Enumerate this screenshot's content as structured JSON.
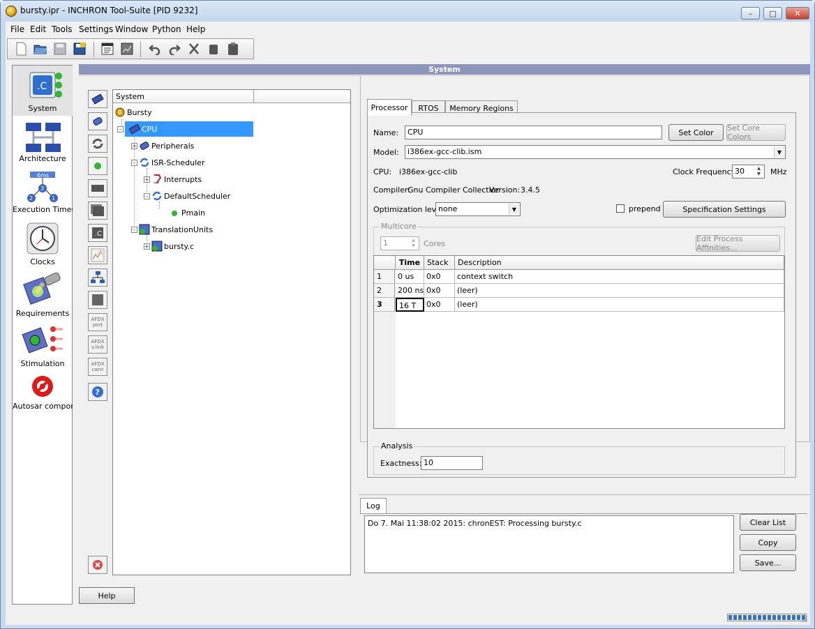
{
  "window": {
    "title": "bursty.ipr - INCHRON Tool-Suite [PID 9232]",
    "buttons": {
      "minimize": "–",
      "maximize": "□",
      "close": "✕"
    }
  },
  "menubar": {
    "items": [
      "File",
      "Edit",
      "Tools",
      "Settings",
      "Window",
      "Python",
      "Help"
    ]
  },
  "toolbar": {
    "icons": [
      "new-document-icon",
      "open-icon",
      "save-icon",
      "save-all-icon",
      "properties-icon",
      "report-icon",
      "undo-icon",
      "redo-icon",
      "cut-icon",
      "copy-icon",
      "paste-icon"
    ]
  },
  "leftnav": {
    "items": [
      {
        "label": "System",
        "icon": "system-icon"
      },
      {
        "label": "Architecture",
        "icon": "architecture-icon"
      },
      {
        "label": "Execution Times",
        "icon": "execution-times-icon",
        "badge": "6ms"
      },
      {
        "label": "Clocks",
        "icon": "clock-icon"
      },
      {
        "label": "Requirements",
        "icon": "requirements-icon"
      },
      {
        "label": "Stimulation",
        "icon": "stimulation-icon"
      },
      {
        "label": "Autosar componen",
        "icon": "autosar-icon"
      }
    ]
  },
  "main": {
    "header": "System",
    "vtools": [
      {
        "name": "add-cpu-tool",
        "text": ""
      },
      {
        "name": "add-peripheral-tool",
        "text": ""
      },
      {
        "name": "add-scheduler-tool",
        "text": ""
      },
      {
        "name": "add-process-tool",
        "text": ""
      },
      {
        "name": "add-block-tool",
        "text": ""
      },
      {
        "name": "add-stack-tool",
        "text": ""
      },
      {
        "name": "add-c-file-tool",
        "text": ""
      },
      {
        "name": "add-signal-tool",
        "text": ""
      },
      {
        "name": "add-network-tool",
        "text": ""
      },
      {
        "name": "add-square-tool",
        "text": ""
      },
      {
        "name": "afdx-port-tool",
        "text": "AFDX port"
      },
      {
        "name": "afdx-vlink-tool",
        "text": "AFDX v.link"
      },
      {
        "name": "afdx-conn-tool",
        "text": "AFDX conn"
      },
      {
        "name": "help-tool",
        "text": ""
      }
    ],
    "tree": {
      "header": "System",
      "nodes": [
        {
          "label": "Bursty",
          "level": 0,
          "icon": "project-icon"
        },
        {
          "label": "CPU",
          "level": 1,
          "icon": "cpu-icon",
          "selected": true
        },
        {
          "label": "Peripherals",
          "level": 2,
          "icon": "peripherals-icon"
        },
        {
          "label": "ISR-Scheduler",
          "level": 2,
          "icon": "scheduler-icon"
        },
        {
          "label": "Interrupts",
          "level": 3,
          "icon": "interrupts-icon"
        },
        {
          "label": "DefaultScheduler",
          "level": 3,
          "icon": "scheduler-icon"
        },
        {
          "label": "Pmain",
          "level": 4,
          "icon": "process-icon"
        },
        {
          "label": "TranslationUnits",
          "level": 2,
          "icon": "translation-units-icon"
        },
        {
          "label": "bursty.c",
          "level": 3,
          "icon": "c-file-icon"
        }
      ]
    }
  },
  "tabs": [
    "Processor",
    "RTOS",
    "Memory Regions"
  ],
  "processor": {
    "name_label": "Name:",
    "name_value": "CPU",
    "set_color": "Set Color",
    "set_core_colors": "Set Core Colors",
    "model_label": "Model:",
    "model_value": "i386ex-gcc-clib.ism",
    "cpu_label": "CPU:",
    "cpu_value": "i386ex-gcc-clib",
    "clock_label": "Clock Frequency",
    "clock_value": "30",
    "clock_unit": "MHz",
    "compiler_label": "Compiler:",
    "compiler_value": "Gnu Compiler Collection",
    "version_label": "Version:",
    "version_value": "3.4.5",
    "opt_label": "Optimization level",
    "opt_value": "none",
    "prepend_label": "prepend",
    "spec_settings": "Specification Settings",
    "multicore_title": "Multicore",
    "cores_value": "1",
    "cores_label": "Cores",
    "edit_affinities": "Edit Process Affinities...",
    "table": {
      "columns": [
        "Time",
        "Stack",
        "Description"
      ],
      "rows": [
        {
          "num": "1",
          "time": "0 us",
          "stack": "0x0",
          "desc": "context switch"
        },
        {
          "num": "2",
          "time": "200 ns",
          "stack": "0x0",
          "desc": "(leer)"
        },
        {
          "num": "3",
          "time": "16 T",
          "stack": "0x0",
          "desc": "(leer)"
        }
      ]
    },
    "analysis_title": "Analysis",
    "exactness_label": "Exactness:",
    "exactness_value": "10"
  },
  "log": {
    "tab": "Log",
    "text": "Do 7. Mai 11:38:02 2015: chronEST: Processing  bursty.c",
    "clear_list": "Clear List",
    "copy": "Copy",
    "save": "Save..."
  },
  "help_button": "Help",
  "progress": 1.0
}
